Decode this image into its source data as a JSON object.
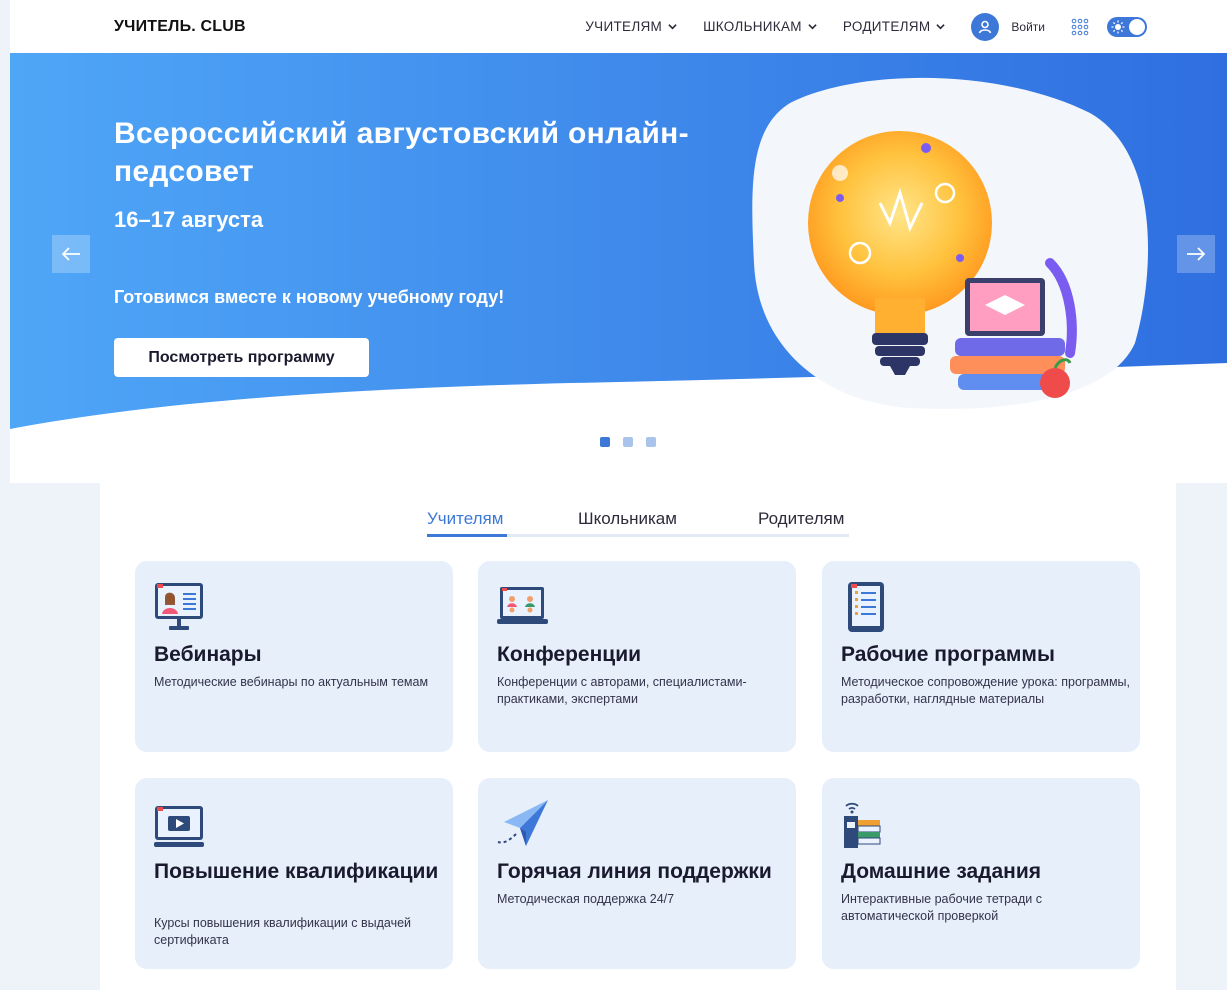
{
  "header": {
    "logo": "УЧИТЕЛЬ. CLUB",
    "nav": [
      {
        "label": "УЧИТЕЛЯМ"
      },
      {
        "label": "ШКОЛЬНИКАМ"
      },
      {
        "label": "РОДИТЕЛЯМ"
      }
    ],
    "login_label": "Войти"
  },
  "hero": {
    "title": "Всероссийский августовский онлайн-педсовет",
    "date": "16–17 августа",
    "subtitle": "Готовимся вместе к новому учебному году!",
    "button_label": "Посмотреть программу",
    "slides_count": 3,
    "active_slide": 1
  },
  "tabs": [
    {
      "label": "Учителям",
      "active": true
    },
    {
      "label": "Школьникам",
      "active": false
    },
    {
      "label": "Родителям",
      "active": false
    }
  ],
  "cards": [
    {
      "title": "Вебинары",
      "description": "Методические вебинары по актуальным темам",
      "icon": "webinar-monitor-icon"
    },
    {
      "title": "Конференции",
      "description": "Конференции с авторами, специалистами-практиками, экспертами",
      "icon": "conference-laptop-icon"
    },
    {
      "title": "Рабочие программы",
      "description": "Методическое сопровождение урока: программы, разработки, наглядные материалы",
      "icon": "tablet-document-icon"
    },
    {
      "title": "Повышение квалификации",
      "description": "Курсы повышения квалификации с выдачей сертификата",
      "icon": "video-monitor-icon"
    },
    {
      "title": "Горячая линия поддержки",
      "description": "Методическая поддержка 24/7",
      "icon": "paper-plane-icon"
    },
    {
      "title": "Домашние задания",
      "description": "Интерактивные рабочие тетради с автоматической проверкой",
      "icon": "workbook-wifi-icon"
    }
  ],
  "colors": {
    "accent": "#3d78d8",
    "hero_blue": "#3f8ef0",
    "card_bg": "#e7effb"
  }
}
